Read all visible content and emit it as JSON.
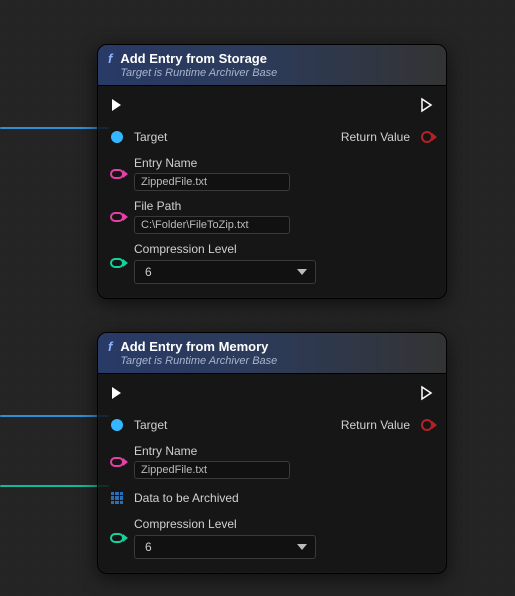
{
  "nodes": [
    {
      "id": "storage",
      "title": "Add Entry from Storage",
      "subtitle": "Target is Runtime Archiver Base",
      "target_label": "Target",
      "return_label": "Return Value",
      "entry_name_label": "Entry Name",
      "entry_name_value": "ZippedFile.txt",
      "file_path_label": "File Path",
      "file_path_value": "C:\\Folder\\FileToZip.txt",
      "compression_label": "Compression Level",
      "compression_value": "6"
    },
    {
      "id": "memory",
      "title": "Add Entry from Memory",
      "subtitle": "Target is Runtime Archiver Base",
      "target_label": "Target",
      "return_label": "Return Value",
      "entry_name_label": "Entry Name",
      "entry_name_value": "ZippedFile.txt",
      "data_label": "Data to be Archived",
      "compression_label": "Compression Level",
      "compression_value": "6"
    }
  ],
  "wires": {
    "color_blue": "#2f8fd6",
    "color_teal": "#12b99a"
  }
}
